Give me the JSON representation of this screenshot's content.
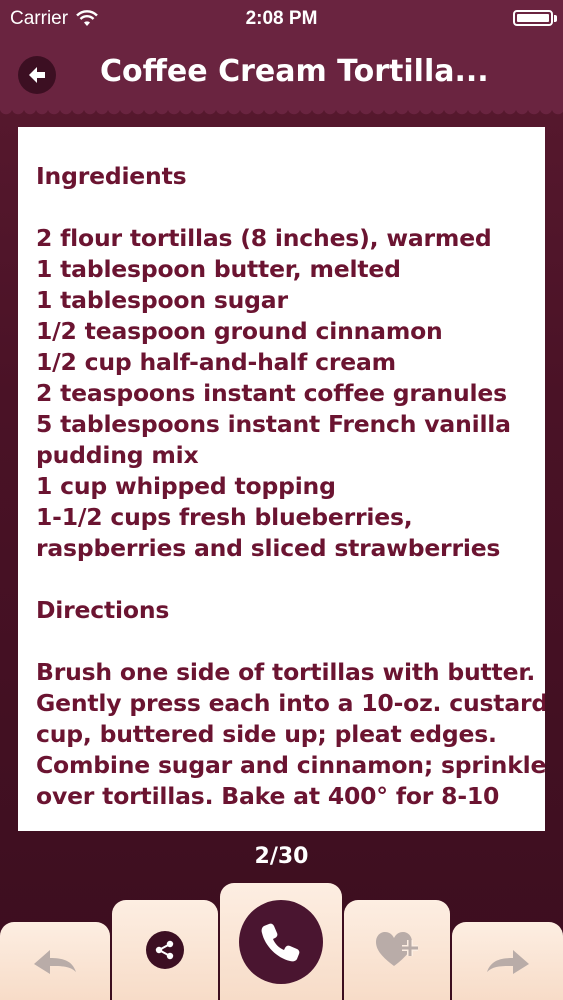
{
  "status_bar": {
    "carrier": "Carrier",
    "time": "2:08 PM"
  },
  "header": {
    "title": "Coffee Cream Tortilla..."
  },
  "recipe": {
    "ingredients_heading": "Ingredients",
    "ingredients_lines": [
      "2 flour tortillas (8 inches), warmed",
      "1 tablespoon butter, melted",
      "1 tablespoon sugar",
      "1/2 teaspoon ground cinnamon",
      "1/2 cup half-and-half cream",
      "2 teaspoons instant coffee granules",
      "5 tablespoons instant French vanilla",
      "pudding mix",
      "1 cup whipped topping",
      "1-1/2 cups fresh blueberries,",
      "raspberries and sliced strawberries"
    ],
    "directions_heading": "Directions",
    "directions_lines": [
      "Brush one side of tortillas with butter.",
      "Gently press each into a 10-oz. custard",
      "cup, buttered side up; pleat edges.",
      "Combine sugar and cinnamon; sprinkle",
      "over tortillas. Bake at 400° for 8-10"
    ]
  },
  "pager": {
    "text": "2/30"
  },
  "toolbar": {
    "icons": [
      "back-arrow-icon",
      "share-icon",
      "phone-icon",
      "heart-plus-icon",
      "forward-arrow-icon"
    ]
  },
  "colors": {
    "brand": "#6a2440",
    "text": "#6b1431",
    "button_bg": "#fdeee2"
  }
}
